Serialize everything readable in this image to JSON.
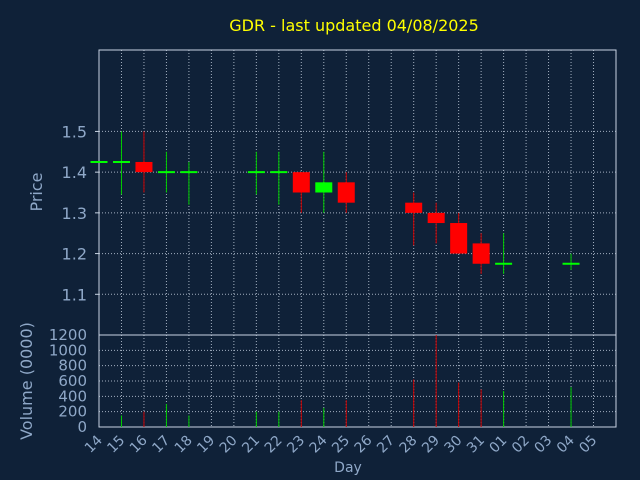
{
  "chart_data": {
    "type": "candlestick",
    "title": "GDR - last updated 04/08/2025",
    "xlabel": "Day",
    "price_panel": {
      "ylabel": "Price",
      "ylim": [
        1.0,
        1.7
      ],
      "yticks": [
        "1.1",
        "1.2",
        "1.3",
        "1.4",
        "1.5"
      ]
    },
    "volume_panel": {
      "ylabel": "Volume (0000)",
      "ylim": [
        0,
        1200
      ],
      "yticks": [
        "0",
        "200",
        "400",
        "600",
        "800",
        "1000",
        "1200"
      ]
    },
    "x_tick_labels": [
      "14",
      "15",
      "16",
      "17",
      "18",
      "19",
      "20",
      "21",
      "22",
      "23",
      "24",
      "25",
      "26",
      "27",
      "28",
      "29",
      "30",
      "31",
      "01",
      "02",
      "03",
      "04",
      "05"
    ],
    "grid": true,
    "colors": {
      "background": "#0f2138",
      "title": "#ffff00",
      "axis_text": "#8fa8c8",
      "axis_line": "#c8d4e3",
      "grid": "#c8d4e3",
      "up": "#00ff00",
      "down": "#ff0000",
      "wick_up": "#00cc00",
      "wick_down": "#cc0000"
    },
    "candles": [
      {
        "x": 14,
        "open": 1.425,
        "close": 1.425,
        "high": 1.425,
        "low": 1.425,
        "volume": 0
      },
      {
        "x": 15,
        "open": 1.425,
        "close": 1.425,
        "high": 1.5,
        "low": 1.345,
        "volume": 150
      },
      {
        "x": 16,
        "open": 1.425,
        "close": 1.4,
        "high": 1.5,
        "low": 1.35,
        "volume": 200
      },
      {
        "x": 17,
        "open": 1.4,
        "close": 1.4,
        "high": 1.45,
        "low": 1.35,
        "volume": 300
      },
      {
        "x": 18,
        "open": 1.4,
        "close": 1.4,
        "high": 1.425,
        "low": 1.32,
        "volume": 150
      },
      {
        "x": 21,
        "open": 1.4,
        "close": 1.4,
        "high": 1.45,
        "low": 1.345,
        "volume": 200
      },
      {
        "x": 22,
        "open": 1.4,
        "close": 1.4,
        "high": 1.45,
        "low": 1.32,
        "volume": 200
      },
      {
        "x": 23,
        "open": 1.4,
        "close": 1.35,
        "high": 1.4,
        "low": 1.3,
        "volume": 350
      },
      {
        "x": 24,
        "open": 1.35,
        "close": 1.375,
        "high": 1.45,
        "low": 1.3,
        "volume": 250
      },
      {
        "x": 25,
        "open": 1.375,
        "close": 1.325,
        "high": 1.4,
        "low": 1.3,
        "volume": 350
      },
      {
        "x": 28,
        "open": 1.325,
        "close": 1.3,
        "high": 1.35,
        "low": 1.22,
        "volume": 620
      },
      {
        "x": 29,
        "open": 1.3,
        "close": 1.275,
        "high": 1.325,
        "low": 1.225,
        "volume": 1200
      },
      {
        "x": 30,
        "open": 1.275,
        "close": 1.2,
        "high": 1.3,
        "low": 1.2,
        "volume": 580
      },
      {
        "x": 31,
        "open": 1.225,
        "close": 1.175,
        "high": 1.25,
        "low": 1.15,
        "volume": 490
      },
      {
        "x": "01",
        "open": 1.175,
        "close": 1.175,
        "high": 1.25,
        "low": 1.15,
        "volume": 470
      },
      {
        "x": "04",
        "open": 1.175,
        "close": 1.175,
        "high": 1.2,
        "low": 1.16,
        "volume": 520
      }
    ]
  }
}
